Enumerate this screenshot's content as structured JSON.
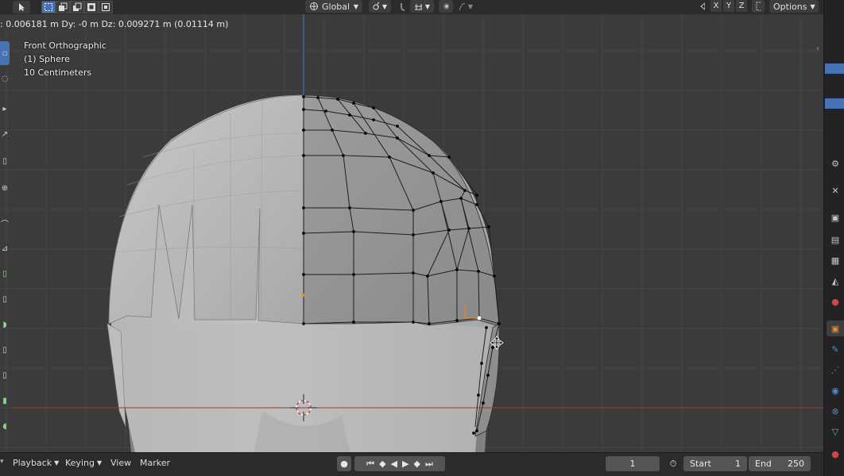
{
  "header": {
    "orientation_label": "Global",
    "axis_x": "X",
    "axis_y": "Y",
    "axis_z": "Z",
    "options_label": "Options"
  },
  "operator_status": ": 0.006181 m  Dy: -0 m  Dz: 0.009271 m (0.01114 m)",
  "viewport": {
    "view_name": "Front Orthographic",
    "object_name": "(1) Sphere",
    "grid_scale": "10 Centimeters"
  },
  "timeline": {
    "playback_label": "Playback",
    "keying_label": "Keying",
    "view_label": "View",
    "marker_label": "Marker",
    "current_frame": "1",
    "start_label": "Start",
    "start_value": "1",
    "end_label": "End",
    "end_value": "250"
  },
  "colors": {
    "viewport_bg": "#3b3b3b",
    "grid_line": "#444444",
    "x_axis": "#9b3b3b",
    "z_axis": "#3d6eb0",
    "mesh_fill": "#9a9a9a",
    "selected_orange": "#e38a2a",
    "active_blue": "#4772b3"
  }
}
